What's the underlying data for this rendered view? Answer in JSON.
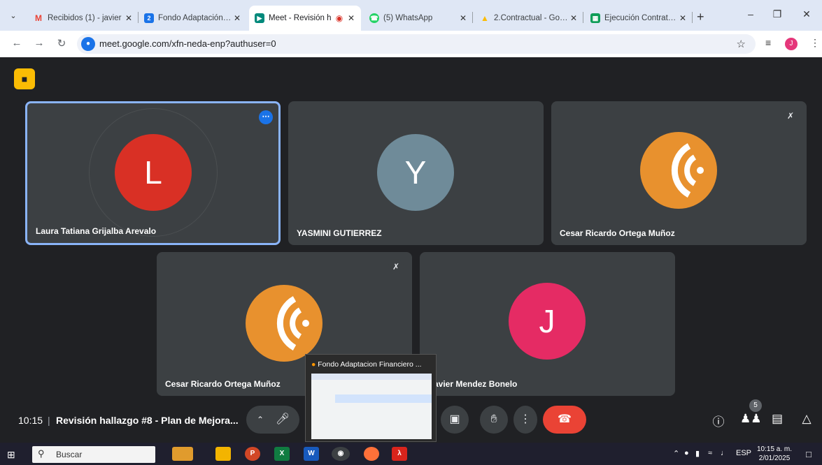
{
  "browser": {
    "tabs": [
      {
        "label": "Recibidos (1) - javier",
        "icon": "gmail-icon",
        "color": "#ea4335"
      },
      {
        "label": "Fondo Adaptación - C",
        "icon": "docs-icon",
        "color": "#1a73e8"
      },
      {
        "label": "Meet - Revisión h",
        "icon": "meet-icon",
        "color": "#00897b"
      },
      {
        "label": "(5) WhatsApp",
        "icon": "whatsapp-icon",
        "color": "#25d366"
      },
      {
        "label": "2.Contractual - Goog",
        "icon": "drive-icon",
        "color": "#fbbc04"
      },
      {
        "label": "Ejecución Contrato C",
        "icon": "sheets-icon",
        "color": "#0f9d58"
      }
    ],
    "tab_favicon_letters": [
      "M",
      "2",
      "",
      "",
      "",
      ""
    ],
    "url": "meet.google.com/xfn-neda-enp?authuser=0",
    "profile_initial": "J"
  },
  "meet": {
    "participants": [
      {
        "name": "Laura Tatiana Grijalba Arevalo",
        "initial": "L",
        "color": "#d93025",
        "speaking": true
      },
      {
        "name": "YASMINI GUTIERREZ",
        "initial": "Y",
        "color": "#6f8b99",
        "speaking": false
      },
      {
        "name": "Cesar Ricardo Ortega Muñoz",
        "initial": "",
        "color": "#e8912e",
        "speaking": false,
        "muted": true
      },
      {
        "name": "Cesar Ricardo Ortega Muñoz",
        "initial": "",
        "color": "#e8912e",
        "speaking": false,
        "muted": true
      },
      {
        "name": "avier Mendez Bonelo",
        "initial": "J",
        "color": "#e52b64",
        "speaking": false
      }
    ],
    "time": "10:15",
    "separator": "|",
    "meeting_title": "Revisión hallazgo #8 - Plan de Mejora...",
    "participant_count": "5"
  },
  "popup": {
    "title": "Fondo Adaptacion Financiero ..."
  },
  "taskbar": {
    "search_placeholder": "Buscar",
    "language": "ESP",
    "clock_time": "10:15 a. m.",
    "clock_date": "2/01/2025"
  }
}
